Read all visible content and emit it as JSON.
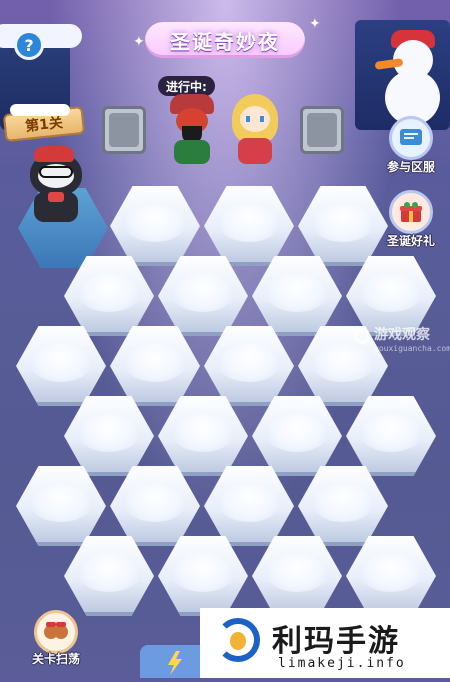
{
  "header": {
    "title": "圣诞奇妙夜",
    "help_label": "?",
    "progress_label": "进行中:"
  },
  "level": {
    "label": "第1关"
  },
  "side_buttons": {
    "server_label": "参与区服",
    "gift_label": "圣诞好礼"
  },
  "bottom": {
    "sweep_label": "关卡扫荡"
  },
  "watermarks": {
    "game_site": "游戏观察",
    "game_site_url": "youxiguancha.com",
    "brand_name": "利玛手游",
    "brand_url": "limakeji.info"
  },
  "board": {
    "rows": 6,
    "revealed_tiles": [
      [
        0,
        0
      ]
    ],
    "tile_type": "snow"
  },
  "colors": {
    "background": "#585c98",
    "snow": "#f7f9ff",
    "accent": "#7b33b7"
  }
}
